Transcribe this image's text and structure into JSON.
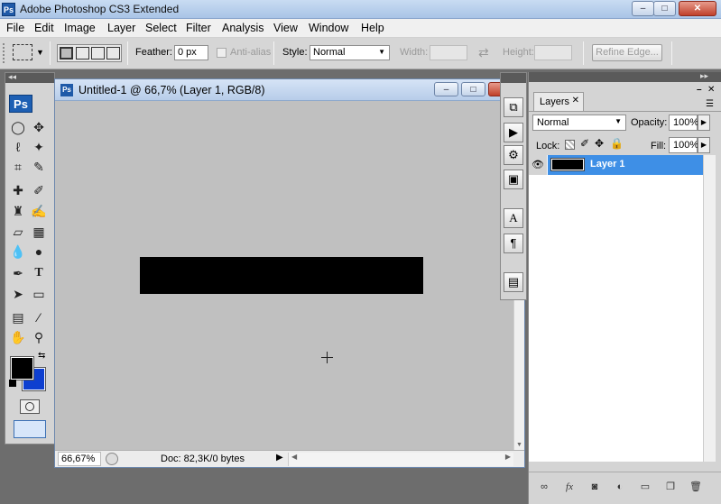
{
  "window": {
    "title": "Adobe Photoshop CS3 Extended",
    "app_icon": "Ps",
    "minimize": "–",
    "maximize": "□",
    "close": "✕"
  },
  "menubar": [
    "File",
    "Edit",
    "Image",
    "Layer",
    "Select",
    "Filter",
    "Analysis",
    "View",
    "Window",
    "Help"
  ],
  "options": {
    "feather_label": "Feather:",
    "feather_value": "0 px",
    "antialias_label": "Anti-alias",
    "style_label": "Style:",
    "style_value": "Normal",
    "width_label": "Width:",
    "height_label": "Height:",
    "refine_edge": "Refine Edge..."
  },
  "tools": {
    "logo": "Ps"
  },
  "document": {
    "title": "Untitled-1 @ 66,7% (Layer 1, RGB/8)",
    "icon": "Ps",
    "zoom": "66,67%",
    "doc_info": "Doc: 82,3K/0 bytes"
  },
  "layers": {
    "tab": "Layers",
    "blend_mode": "Normal",
    "opacity_label": "Opacity:",
    "opacity_value": "100%",
    "lock_label": "Lock:",
    "fill_label": "Fill:",
    "fill_value": "100%",
    "items": [
      {
        "name": "Layer 1"
      }
    ]
  },
  "colors": {
    "foreground": "#000000",
    "background": "#0e3fd0",
    "selection": "#3e8fe6"
  }
}
